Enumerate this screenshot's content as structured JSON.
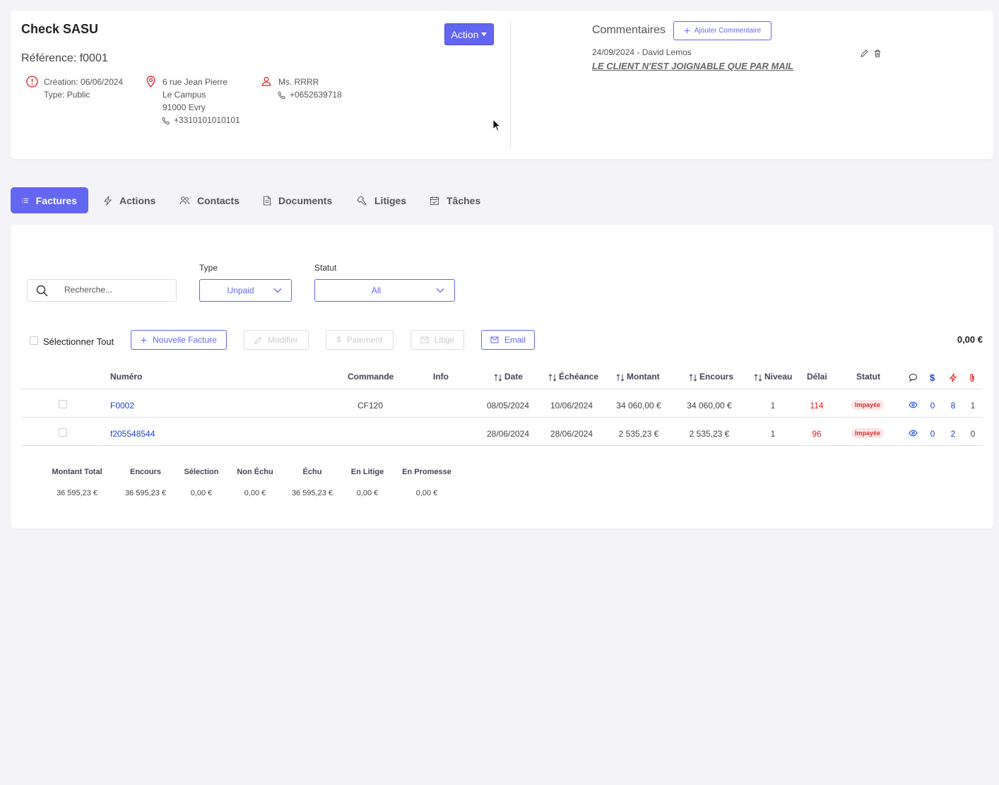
{
  "client": {
    "name": "Check SASU",
    "reference": "Référence: f0001",
    "creation": "Création: 06/06/2024",
    "type": "Type: Public",
    "address": [
      "6 rue Jean Pierre",
      "Le Campus",
      "91000 Evry"
    ],
    "phone": "+3310101010101",
    "contact_name": "Ms. RRRR",
    "contact_phone": "+0652639718",
    "action_label": "Action"
  },
  "comments": {
    "title": "Commentaires",
    "add_label": "Ajouter Commentaire",
    "items": [
      {
        "meta": "24/09/2024 - David Lemos",
        "text": "LE CLIENT N'EST JOIGNABLE QUE PAR MAIL"
      }
    ]
  },
  "tabs": [
    {
      "label": "Factures",
      "icon": "list-icon",
      "active": true
    },
    {
      "label": "Actions",
      "icon": "bolt-icon"
    },
    {
      "label": "Contacts",
      "icon": "users-icon"
    },
    {
      "label": "Documents",
      "icon": "document-icon"
    },
    {
      "label": "Litiges",
      "icon": "hammer-icon"
    },
    {
      "label": "Tâches",
      "icon": "calendar-icon"
    }
  ],
  "filters": {
    "search_placeholder": "Recherche...",
    "type_label": "Type",
    "type_value": "Unpaid",
    "status_label": "Statut",
    "status_value": "All"
  },
  "toolbar": {
    "select_all": "Sélectionner Tout",
    "new_invoice": "Nouvelle Facture",
    "modify": "Modifier",
    "payment": "Paiement",
    "dispute": "Litige",
    "email": "Email",
    "total": "0,00 €"
  },
  "table": {
    "headers": {
      "numero": "Numéro",
      "commande": "Commande",
      "info": "Info",
      "date": "Date",
      "echeance": "Échéance",
      "montant": "Montant",
      "encours": "Encours",
      "niveau": "Niveau",
      "delai": "Délai",
      "statut": "Statut"
    },
    "rows": [
      {
        "numero": "F0002",
        "commande": "CF120",
        "info": "",
        "date": "08/05/2024",
        "echeance": "10/06/2024",
        "montant": "34 060,00 €",
        "encours": "34 060,00 €",
        "niveau": "1",
        "delai": "114",
        "statut": "Impayée",
        "comments": "0",
        "actions": "8",
        "attachments": "1"
      },
      {
        "numero": "f205548544",
        "commande": "",
        "info": "",
        "date": "28/06/2024",
        "echeance": "28/06/2024",
        "montant": "2 535,23 €",
        "encours": "2 535,23 €",
        "niveau": "1",
        "delai": "96",
        "statut": "Impayée",
        "comments": "0",
        "actions": "2",
        "attachments": "0"
      }
    ]
  },
  "summary": [
    {
      "label": "Montant Total",
      "value": "36 595,23 €"
    },
    {
      "label": "Encours",
      "value": "36 595,23 €"
    },
    {
      "label": "Sélection",
      "value": "0,00 €"
    },
    {
      "label": "Non Échu",
      "value": "0,00 €"
    },
    {
      "label": "Échu",
      "value": "36 595,23 €"
    },
    {
      "label": "En Litige",
      "value": "0,00 €"
    },
    {
      "label": "En Promesse",
      "value": "0,00 €"
    }
  ],
  "colors": {
    "accent": "#6366f1",
    "link": "#1a44d4",
    "danger": "#e02020",
    "badge_bg": "#fde4e4"
  }
}
